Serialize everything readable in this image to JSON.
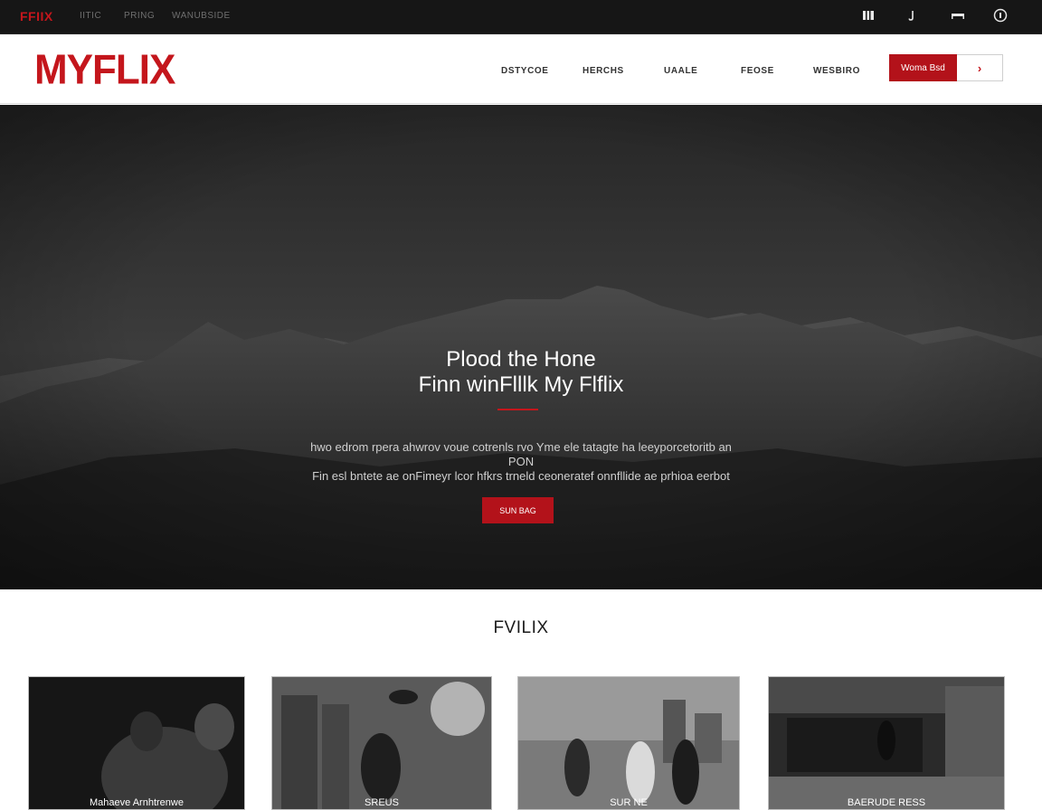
{
  "topbar": {
    "brand": "FFIIX",
    "links": [
      "IITIC",
      "PRING",
      "WANUBSIDE"
    ],
    "icons": [
      "bookmark-icon",
      "music-icon",
      "minus-icon",
      "info-circle-icon"
    ]
  },
  "header": {
    "logo": "MYFLIX",
    "nav": [
      "DSTYCOE",
      "HERCHS",
      "UAALE",
      "FEOSE",
      "WESBIRO"
    ],
    "cta_label": "Woma Bsd",
    "cta_arrow": "›"
  },
  "hero": {
    "title_line1": "Plood the Hone",
    "title_line2": "Finn winFlllk My Flflix",
    "body_line1": "hwo edrom rpera ahwrov voue cotrenls rvo Yme ele tatagte ha leeyporcetoritb an",
    "body_line2": "PON",
    "body_line3": "Fin esl bntete ae onFimeyr lcor hfkrs trneld ceoneratef onnfllide ae prhioa eerbot",
    "button_label": "SUN BAG"
  },
  "section": {
    "title": "FVILIX",
    "cards": [
      {
        "label": "Mahaeve Arnhtrenwe"
      },
      {
        "label": "SREUS"
      },
      {
        "label": "SUR NE"
      },
      {
        "label": "BAERUDE RESS"
      }
    ]
  },
  "colors": {
    "brand_red": "#c4161c",
    "button_red": "#b3121a",
    "topbar_bg": "#161616"
  }
}
